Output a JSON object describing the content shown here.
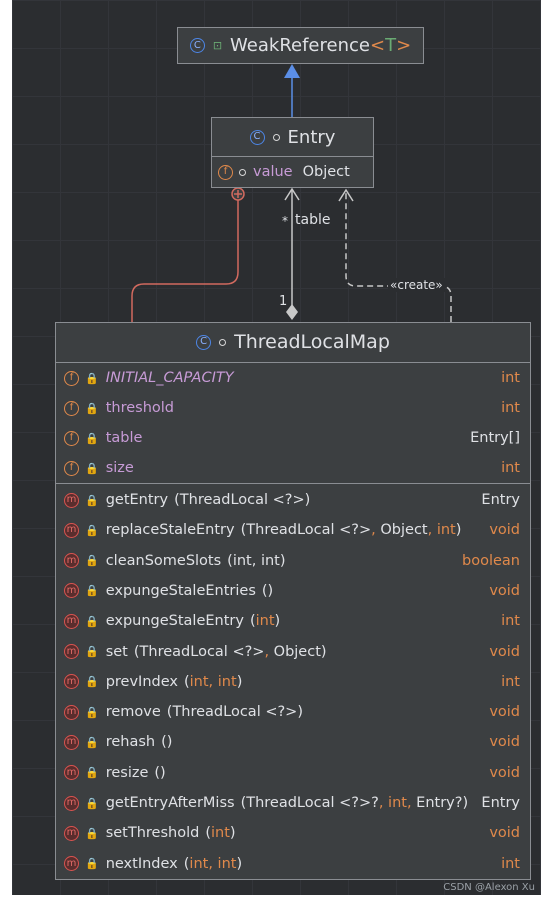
{
  "weakref": {
    "name": "WeakReference",
    "type_param_open": "<",
    "type_param": "T",
    "type_param_close": ">"
  },
  "entry": {
    "name": "Entry",
    "field_name": "value",
    "field_type": "Object"
  },
  "relations": {
    "table_mult": "*",
    "table_label": "table",
    "map_mult": "1",
    "create_label": "«create»"
  },
  "map": {
    "name": "ThreadLocalMap",
    "fields": [
      {
        "name": "INITIAL_CAPACITY",
        "type": "int",
        "italic": true
      },
      {
        "name": "threshold",
        "type": "int"
      },
      {
        "name": "table",
        "type": "Entry[]"
      },
      {
        "name": "size",
        "type": "int"
      }
    ],
    "methods": [
      {
        "name": "getEntry",
        "params": [
          [
            "(",
            "w"
          ],
          [
            "ThreadLocal <?>",
            "w"
          ],
          [
            ")",
            "w"
          ]
        ],
        "ret": "Entry"
      },
      {
        "name": "replaceStaleEntry",
        "params": [
          [
            "(",
            "w"
          ],
          [
            "ThreadLocal <?>",
            "w"
          ],
          [
            ", ",
            "o"
          ],
          [
            "Object",
            "w"
          ],
          [
            ", ",
            "o"
          ],
          [
            "int",
            "o"
          ],
          [
            ")",
            "w"
          ]
        ],
        "ret": "void"
      },
      {
        "name": "cleanSomeSlots",
        "params": [
          [
            "(",
            "w"
          ],
          [
            "int, int",
            "w"
          ],
          [
            ")",
            "w"
          ]
        ],
        "ret": "boolean"
      },
      {
        "name": "expungeStaleEntries",
        "params": [
          [
            "()",
            "w"
          ]
        ],
        "ret": "void"
      },
      {
        "name": "expungeStaleEntry",
        "params": [
          [
            "(",
            "w"
          ],
          [
            "int",
            "o"
          ],
          [
            ")",
            "w"
          ]
        ],
        "ret": "int"
      },
      {
        "name": "set",
        "params": [
          [
            "(",
            "w"
          ],
          [
            "ThreadLocal <?>",
            "w"
          ],
          [
            ", ",
            "o"
          ],
          [
            "Object",
            "w"
          ],
          [
            ")",
            "w"
          ]
        ],
        "ret": "void"
      },
      {
        "name": "prevIndex",
        "params": [
          [
            "(",
            "w"
          ],
          [
            "int, int",
            "o"
          ],
          [
            ")",
            "w"
          ]
        ],
        "ret": "int",
        "static": true
      },
      {
        "name": "remove",
        "params": [
          [
            "(",
            "w"
          ],
          [
            "ThreadLocal <?>",
            "w"
          ],
          [
            ")",
            "w"
          ]
        ],
        "ret": "void"
      },
      {
        "name": "rehash",
        "params": [
          [
            "()",
            "w"
          ]
        ],
        "ret": "void"
      },
      {
        "name": "resize",
        "params": [
          [
            "()",
            "w"
          ]
        ],
        "ret": "void"
      },
      {
        "name": "getEntryAfterMiss",
        "params": [
          [
            "(",
            "w"
          ],
          [
            "ThreadLocal <?>",
            "w"
          ],
          [
            "?",
            "w"
          ],
          [
            ", ",
            "o"
          ],
          [
            "int",
            "o"
          ],
          [
            ", ",
            "o"
          ],
          [
            "Entry",
            "w"
          ],
          [
            "?",
            "w"
          ],
          [
            ")",
            "w"
          ]
        ],
        "ret": "Entry"
      },
      {
        "name": "setThreshold",
        "params": [
          [
            "(",
            "w"
          ],
          [
            "int",
            "o"
          ],
          [
            ")",
            "w"
          ]
        ],
        "ret": "void"
      },
      {
        "name": "nextIndex",
        "params": [
          [
            "(",
            "w"
          ],
          [
            "int, int",
            "o"
          ],
          [
            ")",
            "w"
          ]
        ],
        "ret": "int",
        "static": true
      }
    ]
  },
  "colors": {
    "background": "#2b2d30",
    "box": "#3c3f41",
    "border": "#8a8d92",
    "inherit_arrow": "#5b8ee6",
    "inner_class_link": "#d26a5f",
    "association": "#c8c8c8",
    "field_icon": "#e0894b",
    "method_icon": "#d9534f",
    "field_name": "#c79bd6"
  },
  "icons": {
    "class": "class-icon",
    "field": "field-icon",
    "method": "method-icon",
    "private": "lock-icon",
    "public": "public-dot-icon"
  },
  "watermark": "CSDN @Alexon Xu"
}
